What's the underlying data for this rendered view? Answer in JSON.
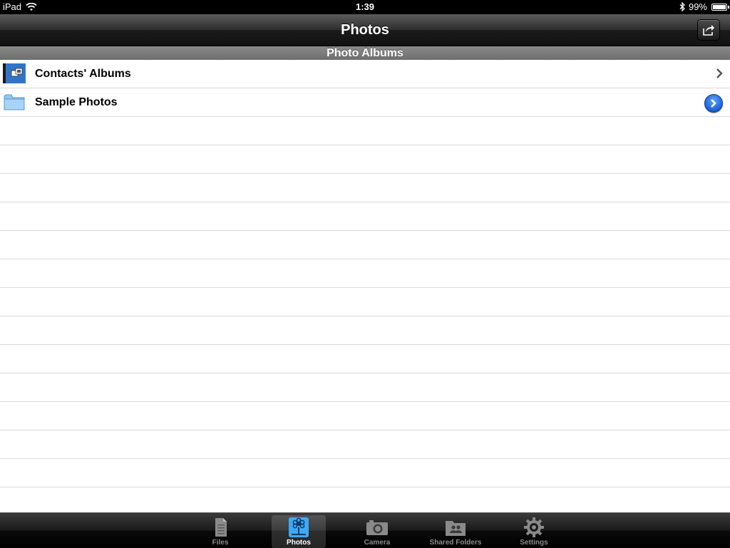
{
  "status_bar": {
    "carrier": "iPad",
    "time": "1:39",
    "battery_percent_label": "99%",
    "battery_level": 0.99,
    "icons": [
      "wifi-icon",
      "bluetooth-icon",
      "battery-icon"
    ]
  },
  "nav_bar": {
    "title": "Photos",
    "share_icon": "share-icon"
  },
  "section": {
    "header": "Photo Albums"
  },
  "rows": [
    {
      "label": "Contacts' Albums",
      "icon": "contacts-album-icon",
      "accessory": "chevron-right-icon"
    },
    {
      "label": "Sample Photos",
      "icon": "folder-icon",
      "accessory": "detail-disclosure-icon"
    }
  ],
  "tab_bar": {
    "tabs": [
      {
        "label": "Files",
        "icon": "document-icon",
        "active": false
      },
      {
        "label": "Photos",
        "icon": "photos-icon",
        "active": true
      },
      {
        "label": "Camera",
        "icon": "camera-icon",
        "active": false
      },
      {
        "label": "Shared Folders",
        "icon": "shared-folder-icon",
        "active": false
      },
      {
        "label": "Settings",
        "icon": "gear-icon",
        "active": false
      }
    ]
  },
  "colors": {
    "accent_blue": "#1d5fd6",
    "tab_active_icon": "#3fa9f5",
    "nav_dark": "#1b1b1b"
  }
}
